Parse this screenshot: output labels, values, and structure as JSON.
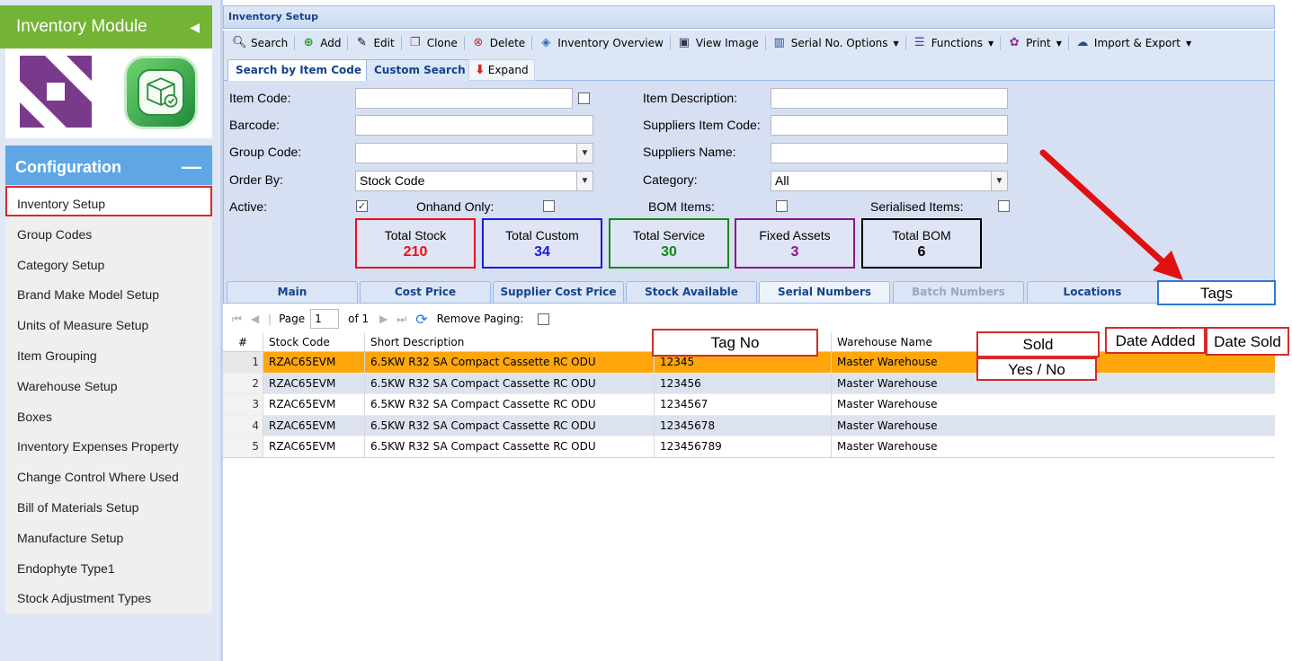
{
  "sidebar": {
    "module_title": "Inventory Module",
    "config_title": "Configuration",
    "items": [
      {
        "label": "Inventory Setup"
      },
      {
        "label": "Group Codes"
      },
      {
        "label": "Category Setup"
      },
      {
        "label": "Brand Make Model Setup"
      },
      {
        "label": "Units of Measure Setup"
      },
      {
        "label": "Item Grouping"
      },
      {
        "label": "Warehouse Setup"
      },
      {
        "label": "Boxes"
      },
      {
        "label": "Inventory Expenses Property"
      },
      {
        "label": "Change Control Where Used"
      },
      {
        "label": "Bill of Materials Setup"
      },
      {
        "label": "Manufacture Setup"
      },
      {
        "label": "Endophyte Type1"
      },
      {
        "label": "Stock Adjustment Types"
      }
    ]
  },
  "main": {
    "title": "Inventory Setup",
    "toolbar": {
      "search": "Search",
      "add": "Add",
      "edit": "Edit",
      "clone": "Clone",
      "delete": "Delete",
      "overview": "Inventory Overview",
      "view_image": "View Image",
      "serial_options": "Serial No. Options",
      "functions": "Functions",
      "print": "Print",
      "import_export": "Import & Export"
    },
    "search_tabs": {
      "by_item_code": "Search by Item Code",
      "custom": "Custom Search",
      "expand": "Expand"
    },
    "form": {
      "item_code_label": "Item Code:",
      "barcode_label": "Barcode:",
      "group_code_label": "Group Code:",
      "order_by_label": "Order By:",
      "order_by_value": "Stock Code",
      "active_label": "Active:",
      "onhand_label": "Onhand Only:",
      "item_desc_label": "Item Description:",
      "supp_item_code_label": "Suppliers Item Code:",
      "supp_name_label": "Suppliers Name:",
      "category_label": "Category:",
      "category_value": "All",
      "bom_label": "BOM Items:",
      "serialised_label": "Serialised Items:"
    },
    "stats": [
      {
        "label": "Total Stock",
        "value": "210",
        "color": "#e8101a"
      },
      {
        "label": "Total Custom",
        "value": "34",
        "color": "#1a1ae0"
      },
      {
        "label": "Total Service",
        "value": "30",
        "color": "#138a13"
      },
      {
        "label": "Fixed Assets",
        "value": "3",
        "color": "#8a148a"
      },
      {
        "label": "Total BOM",
        "value": "6",
        "color": "#000000"
      }
    ],
    "detail_tabs": [
      {
        "label": "Main"
      },
      {
        "label": "Cost Price"
      },
      {
        "label": "Supplier Cost Price"
      },
      {
        "label": "Stock Available"
      },
      {
        "label": "Serial Numbers"
      },
      {
        "label": "Batch Numbers"
      },
      {
        "label": "Locations"
      }
    ],
    "paging": {
      "page_label": "Page",
      "page_value": "1",
      "of_label": "of 1",
      "remove_paging": "Remove Paging:"
    },
    "grid": {
      "columns": [
        "#",
        "Stock Code",
        "Short Description",
        "Warehouse Name"
      ],
      "rows": [
        {
          "n": "1",
          "code": "RZAC65EVM",
          "desc": "6.5KW R32 SA Compact Cassette RC ODU",
          "serial": "12345",
          "wh": "Master Warehouse"
        },
        {
          "n": "2",
          "code": "RZAC65EVM",
          "desc": "6.5KW R32 SA Compact Cassette RC ODU",
          "serial": "123456",
          "wh": "Master Warehouse"
        },
        {
          "n": "3",
          "code": "RZAC65EVM",
          "desc": "6.5KW R32 SA Compact Cassette RC ODU",
          "serial": "1234567",
          "wh": "Master Warehouse"
        },
        {
          "n": "4",
          "code": "RZAC65EVM",
          "desc": "6.5KW R32 SA Compact Cassette RC ODU",
          "serial": "12345678",
          "wh": "Master Warehouse"
        },
        {
          "n": "5",
          "code": "RZAC65EVM",
          "desc": "6.5KW R32 SA Compact Cassette RC ODU",
          "serial": "123456789",
          "wh": "Master Warehouse"
        }
      ]
    }
  },
  "annotations": {
    "tags": "Tags",
    "tag_no": "Tag No",
    "sold": "Sold",
    "yes_no": "Yes / No",
    "date_added": "Date Added",
    "date_sold": "Date Sold"
  },
  "colors": {
    "accent_green": "#73b435",
    "config_blue": "#5ea7e4",
    "selected_row": "#ffa60d",
    "annotation_red": "#d42b2b",
    "annotation_blue": "#2a78d8"
  }
}
